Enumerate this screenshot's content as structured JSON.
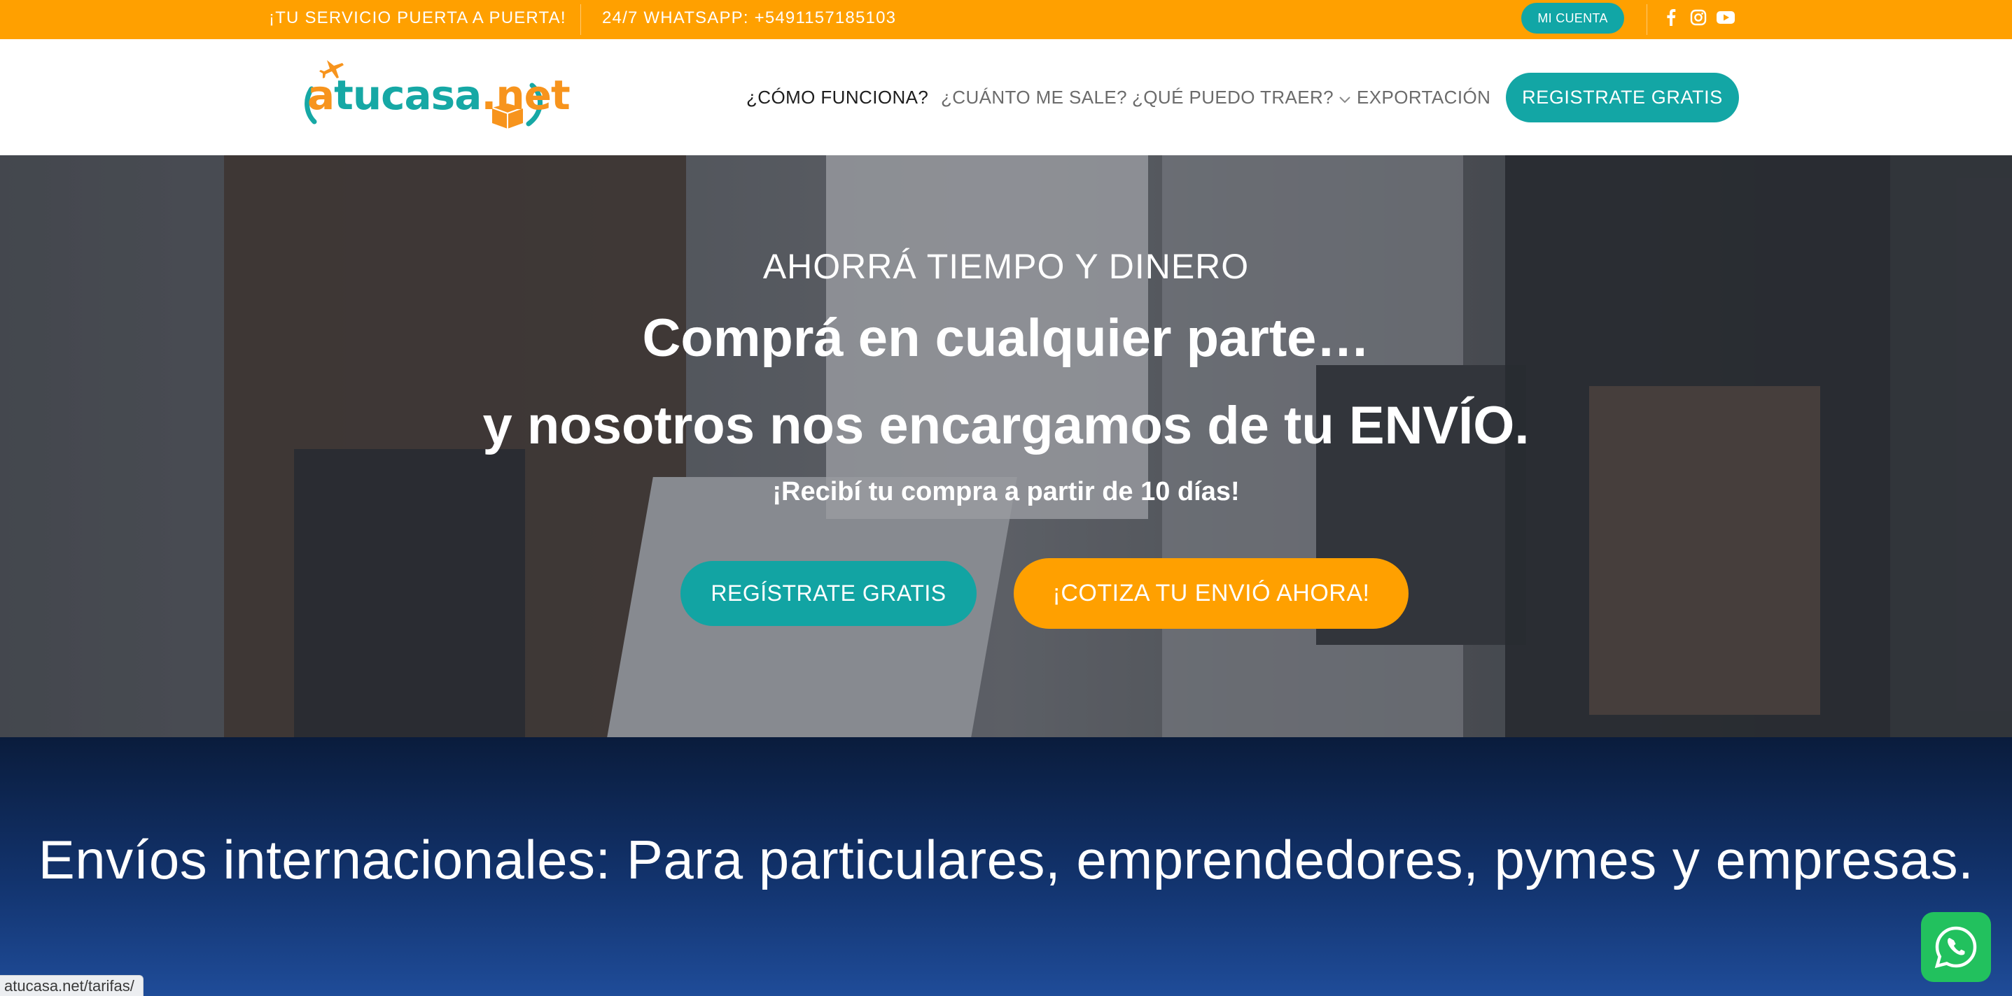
{
  "topbar": {
    "message_left": "¡TU SERVICIO PUERTA A PUERTA!",
    "message_whatsapp": "24/7 WHATSAPP: +5491157185103",
    "account_button": "MI CUENTA",
    "social_icons": [
      "facebook-icon",
      "instagram-icon",
      "youtube-icon"
    ]
  },
  "header": {
    "logo": {
      "part1": "a",
      "part2": "tucasa",
      "part3": ".net"
    },
    "nav": [
      {
        "label": "¿CÓMO FUNCIONA?"
      },
      {
        "label": "¿CUÁNTO ME SALE?"
      },
      {
        "label": "¿QUÉ PUEDO TRAER?",
        "icon": "chevron-down-icon"
      },
      {
        "label": "EXPORTACIÓN"
      }
    ],
    "register_button": "REGISTRATE GRATIS"
  },
  "hero": {
    "eyebrow": "AHORRÁ TIEMPO Y DINERO",
    "headline_line1": "Comprá en cualquier parte…",
    "headline_line2": "y nosotros nos encargamos de tu ENVÍO.",
    "subheadline": "¡Recibí tu compra a partir de 10 días!",
    "primary_button": "REGÍSTRATE GRATIS",
    "secondary_button": "¡COTIZA TU ENVIÓ AHORA!"
  },
  "band": {
    "title": "Envíos internacionales:  Para particulares, emprendedores, pymes y empresas."
  },
  "status_bar": {
    "url": "atucasa.net/tarifas/"
  },
  "whatsapp": {
    "icon": "whatsapp-icon"
  },
  "colors": {
    "accent_orange": "#ffa000",
    "accent_teal": "#13a6a5",
    "band_navy": "#12336d"
  }
}
